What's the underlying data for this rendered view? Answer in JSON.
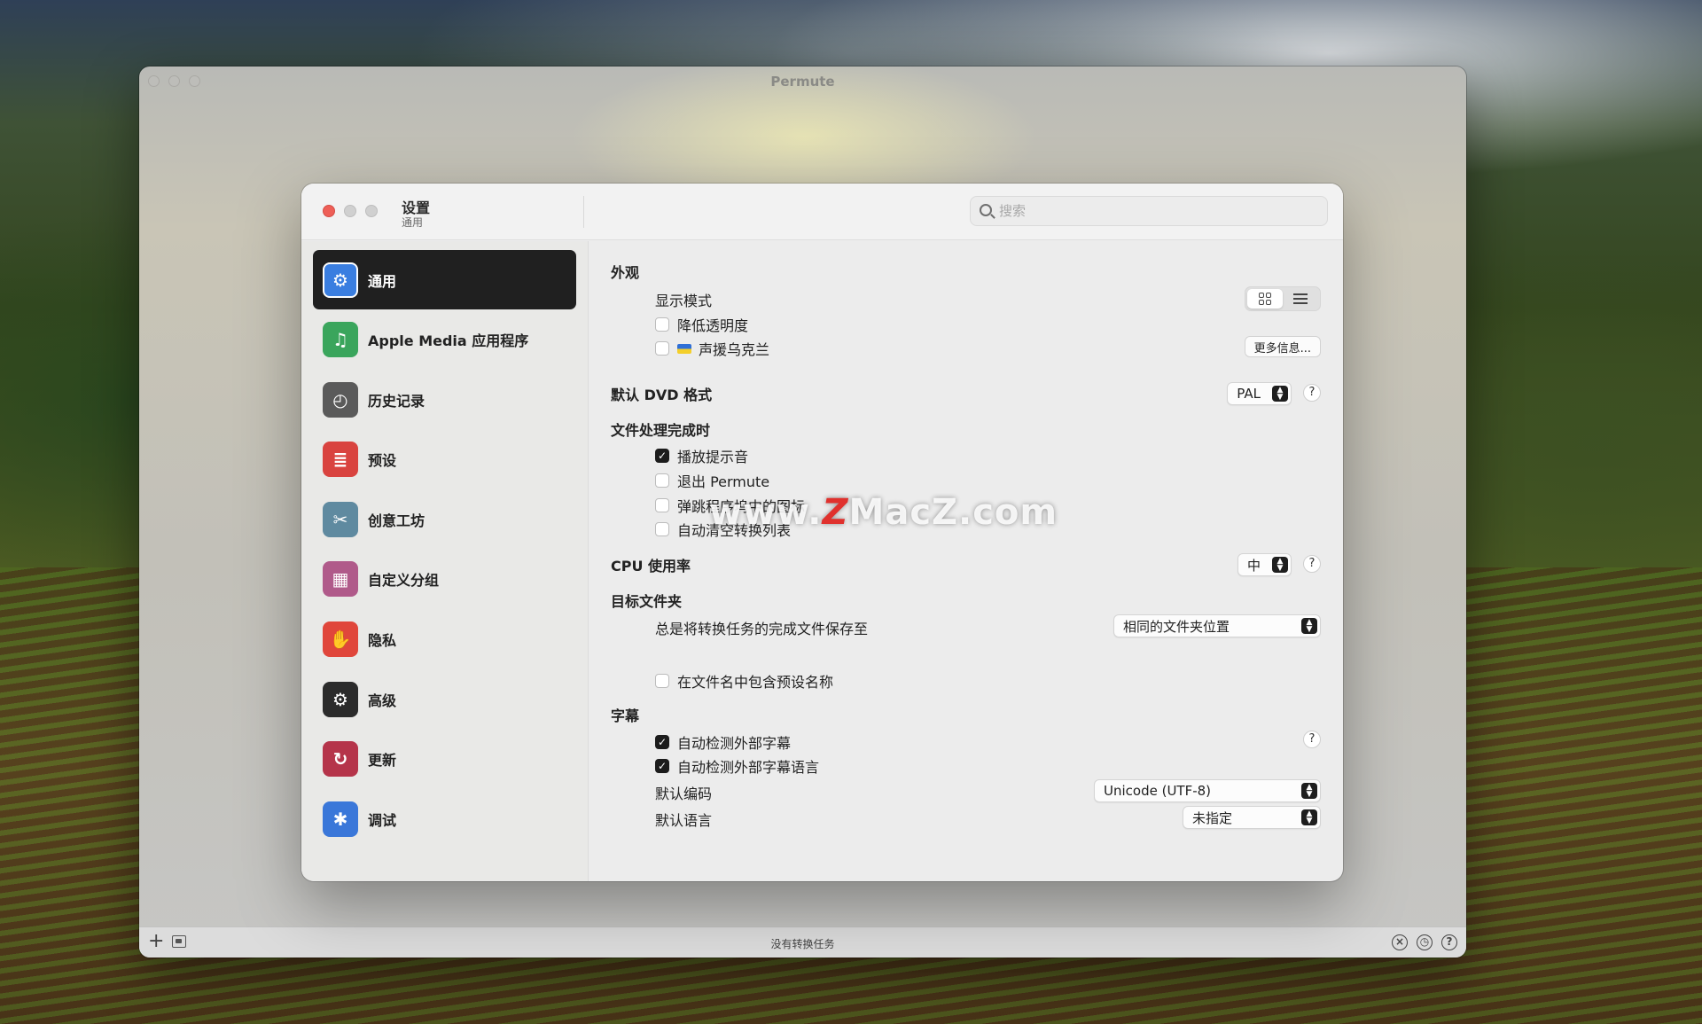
{
  "main_window": {
    "title": "Permute",
    "status": "没有转换任务",
    "add_label": "+",
    "icons": [
      "add-icon",
      "media-browser-icon",
      "stop-all-icon",
      "history-icon",
      "help-icon"
    ]
  },
  "settings": {
    "title": "设置",
    "subtitle": "通用",
    "search_placeholder": "搜索",
    "sidebar": [
      {
        "label": "通用",
        "icon": "gear-icon",
        "color": "#3a7ee0",
        "glyph": "⚙"
      },
      {
        "label": "Apple Media 应用程序",
        "icon": "monitor-music-icon",
        "color": "#3aa55c",
        "glyph": "♫"
      },
      {
        "label": "历史记录",
        "icon": "clock-icon",
        "color": "#5a5a5a",
        "glyph": "◴"
      },
      {
        "label": "预设",
        "icon": "preset-icon",
        "color": "#d9433f",
        "glyph": "≣"
      },
      {
        "label": "创意工坊",
        "icon": "tools-icon",
        "color": "#5f8aa0",
        "glyph": "✂"
      },
      {
        "label": "自定义分组",
        "icon": "groups-icon",
        "color": "#b05a8a",
        "glyph": "▦"
      },
      {
        "label": "隐私",
        "icon": "hand-icon",
        "color": "#e0463b",
        "glyph": "✋"
      },
      {
        "label": "高级",
        "icon": "advanced-gear-icon",
        "color": "#2b2b2b",
        "glyph": "⚙"
      },
      {
        "label": "更新",
        "icon": "refresh-icon",
        "color": "#b5344a",
        "glyph": "↻"
      },
      {
        "label": "调试",
        "icon": "bug-icon",
        "color": "#3a77d9",
        "glyph": "✱"
      }
    ],
    "appearance": {
      "section": "外观",
      "display_mode_label": "显示模式",
      "reduce_transparency_label": "降低透明度",
      "reduce_transparency_checked": false,
      "ukraine_label": "声援乌克兰",
      "ukraine_checked": false,
      "more_info_button": "更多信息..."
    },
    "dvd": {
      "label": "默认 DVD 格式",
      "value": "PAL"
    },
    "on_complete": {
      "section": "文件处理完成时",
      "play_sound_label": "播放提示音",
      "play_sound_checked": true,
      "quit_label": "退出 Permute",
      "quit_checked": false,
      "bounce_dock_label": "弹跳程序坞中的图标",
      "bounce_dock_checked": false,
      "auto_clear_label": "自动清空转换列表",
      "auto_clear_checked": false
    },
    "cpu": {
      "label": "CPU 使用率",
      "value": "中"
    },
    "destination": {
      "section": "目标文件夹",
      "save_label": "总是将转换任务的完成文件保存至",
      "save_value": "相同的文件夹位置",
      "include_preset_label": "在文件名中包含预设名称",
      "include_preset_checked": false
    },
    "subtitles": {
      "section": "字幕",
      "auto_detect_label": "自动检测外部字幕",
      "auto_detect_checked": true,
      "auto_detect_lang_label": "自动检测外部字幕语言",
      "auto_detect_lang_checked": true,
      "encoding_label": "默认编码",
      "encoding_value": "Unicode (UTF-8)",
      "language_label": "默认语言",
      "language_value": "未指定"
    },
    "help_label": "?"
  },
  "watermark": {
    "prefix": "www.",
    "letter": "Z",
    "text": "MacZ.com"
  }
}
